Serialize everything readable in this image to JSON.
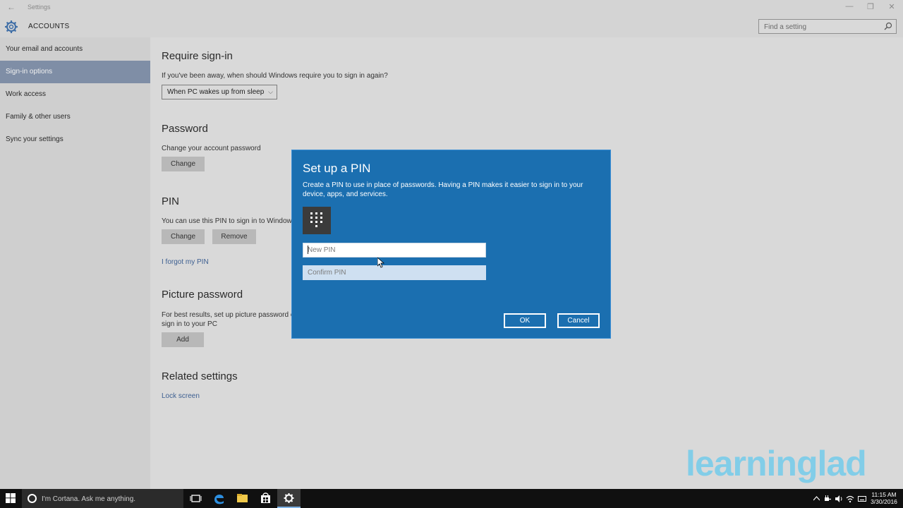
{
  "window": {
    "title": "Settings",
    "back": "←",
    "minimize": "—",
    "restore": "❐",
    "close": "✕"
  },
  "header": {
    "app_title": "ACCOUNTS",
    "search_placeholder": "Find a setting"
  },
  "sidebar": {
    "items": [
      {
        "label": "Your email and accounts"
      },
      {
        "label": "Sign-in options",
        "active": true
      },
      {
        "label": "Work access"
      },
      {
        "label": "Family & other users"
      },
      {
        "label": "Sync your settings"
      }
    ]
  },
  "main": {
    "require_signin": {
      "heading": "Require sign-in",
      "desc": "If you've been away, when should Windows require you to sign in again?",
      "dropdown_value": "When PC wakes up from sleep",
      "chevron": "⌵"
    },
    "password": {
      "heading": "Password",
      "desc": "Change your account password",
      "change_label": "Change"
    },
    "pin": {
      "heading": "PIN",
      "desc": "You can use this PIN to sign in to Window",
      "change_label": "Change",
      "remove_label": "Remove",
      "forgot_link": "I forgot my PIN"
    },
    "picture_password": {
      "heading": "Picture password",
      "desc_line1": "For best results, set up picture password o",
      "desc_line2": "sign in to your PC",
      "add_label": "Add"
    },
    "related": {
      "heading": "Related settings",
      "lock_screen_link": "Lock screen"
    }
  },
  "modal": {
    "title": "Set up a PIN",
    "description": "Create a PIN to use in place of passwords. Having a PIN makes it easier to sign in to your device, apps, and services.",
    "new_pin_placeholder": "New PIN",
    "confirm_pin_placeholder": "Confirm PIN",
    "ok_label": "OK",
    "cancel_label": "Cancel"
  },
  "watermark": "learninglad",
  "taskbar": {
    "cortana_text": "I'm Cortana. Ask me anything.",
    "time": "11:15 AM",
    "date": "3/30/2016",
    "apps": [
      "task-view-icon",
      "edge-icon",
      "file-explorer-icon",
      "store-icon",
      "settings-icon"
    ],
    "active_app": "settings-icon"
  },
  "colors": {
    "modal_bg": "#1b6fb0",
    "sidebar_active": "#7f8ea6",
    "link": "#3d5f91",
    "taskbar": "#101010"
  }
}
